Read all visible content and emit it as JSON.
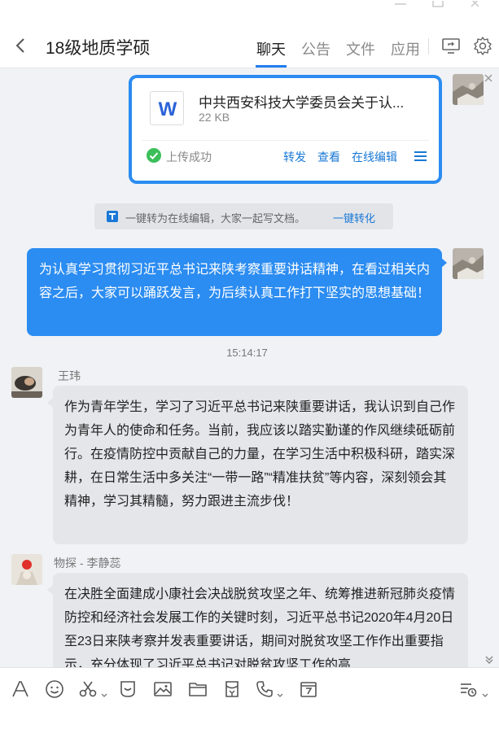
{
  "header": {
    "title": "18级地质学硕",
    "tabs": [
      {
        "label": "聊天",
        "active": true
      },
      {
        "label": "公告",
        "active": false
      },
      {
        "label": "文件",
        "active": false
      },
      {
        "label": "应用",
        "active": false
      }
    ]
  },
  "file_message": {
    "file_type_letter": "W",
    "file_name": "中共西安科技大学委员会关于认...",
    "file_size": "22 KB",
    "status": "上传成功",
    "actions": [
      "转发",
      "查看",
      "在线编辑"
    ]
  },
  "notice": {
    "text": "一键转为在线编辑，大家一起写文档。",
    "link": "一键转化"
  },
  "my_message": {
    "text": "为认真学习贯彻习近平总书记来陕考察重要讲话精神，在看过相关内容之后，大家可以踊跃发言，为后续认真工作打下坚实的思想基础！"
  },
  "timestamp": "15:14:17",
  "messages": [
    {
      "sender": "王玮",
      "text": "作为青年学生，学习了习近平总书记来陕重要讲话，我认识到自己作为青年人的使命和任务。当前，我应该以踏实勤谨的作风继续砥砺前行。在疫情防控中贡献自己的力量，在学习生活中积极科研，踏实深耕，在日常生活中多关注“一带一路”“精准扶贫”等内容，深刻领会其精神，学习其精髓，努力跟进主流步伐！"
    },
    {
      "sender": "物探 - 李静蕊",
      "text": "在决胜全面建成小康社会决战脱贫攻坚之年、统筹推进新冠肺炎疫情防控和经济社会发展工作的关键时刻，习近平总书记2020年4月20日至23日来陕考察并发表重要讲话，期间对脱贫攻坚工作作出重要指示，充分体现了习近平总书记对脱贫攻坚工作的高"
    }
  ],
  "colors": {
    "accent": "#2b8cf1",
    "link": "#1a78d6",
    "bubble_gray": "#e4e6ea",
    "chat_bg": "#f0f2f5",
    "success": "#3cbf5a"
  },
  "toolbar_icons": [
    "font-icon",
    "emoji-icon",
    "scissors-icon",
    "favorites-icon",
    "image-icon",
    "folder-icon",
    "red-packet-icon",
    "phone-icon",
    "calendar-icon",
    "history-icon"
  ]
}
